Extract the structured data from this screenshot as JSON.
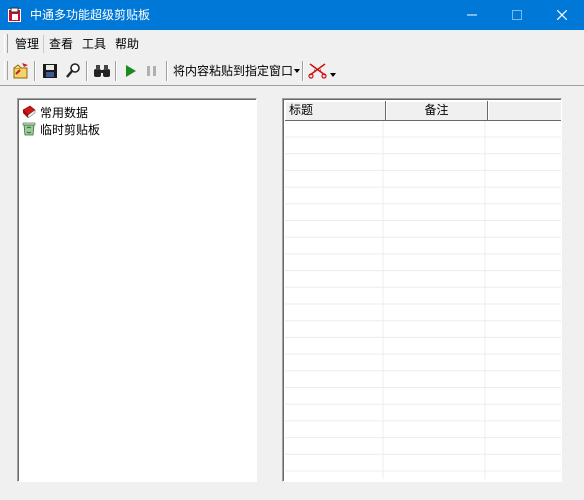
{
  "window": {
    "title": "中通多功能超级剪贴板",
    "controls": [
      "minimize",
      "maximize",
      "close"
    ]
  },
  "menu": {
    "items": [
      {
        "label": "管理"
      },
      {
        "label": "查看"
      },
      {
        "label": "工具"
      },
      {
        "label": "帮助"
      }
    ]
  },
  "toolbar": {
    "buttons": [
      {
        "icon": "new-folder-icon"
      },
      {
        "icon": "save-icon"
      },
      {
        "icon": "search-icon"
      },
      {
        "icon": "find-binoculars-icon"
      },
      {
        "icon": "play-icon"
      },
      {
        "icon": "pause-icon"
      }
    ],
    "paste_label": "将内容粘贴到指定窗口",
    "extra_icon": "cut-scissors-icon"
  },
  "tree": {
    "items": [
      {
        "label": "常用数据",
        "icon": "book-icon"
      },
      {
        "label": "临时剪贴板",
        "icon": "recycle-bin-icon"
      }
    ]
  },
  "list": {
    "columns": [
      {
        "label": "标题"
      },
      {
        "label": "备注"
      },
      {
        "label": ""
      }
    ],
    "rows": []
  },
  "colors": {
    "titlebar": "#0078d7",
    "panel_bg": "#ffffff",
    "window_bg": "#f0f0f0"
  }
}
